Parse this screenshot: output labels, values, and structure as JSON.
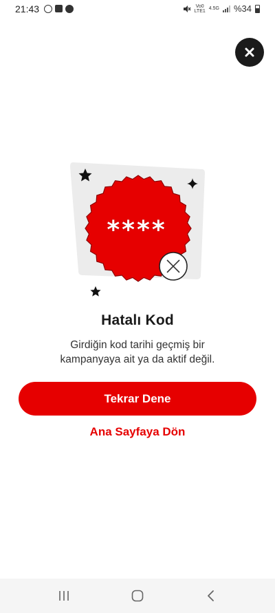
{
  "status_bar": {
    "time": "21:43",
    "network_top": "Vo0",
    "network_bottom": "LTE1",
    "network_type": "4.5G",
    "battery": "%34"
  },
  "icons": {
    "close": "close-icon",
    "nav_recents": "recents-icon",
    "nav_home": "home-icon",
    "nav_back": "back-icon"
  },
  "illustration": {
    "code_mask": "****"
  },
  "dialog": {
    "title": "Hatalı Kod",
    "message": "Girdiğin kod tarihi geçmiş bir kampanyaya ait ya da aktif değil.",
    "primary_label": "Tekrar Dene",
    "secondary_label": "Ana Sayfaya Dön"
  },
  "colors": {
    "accent": "#e60000",
    "close_bg": "#1b1b1b",
    "card_bg": "#ececec"
  }
}
